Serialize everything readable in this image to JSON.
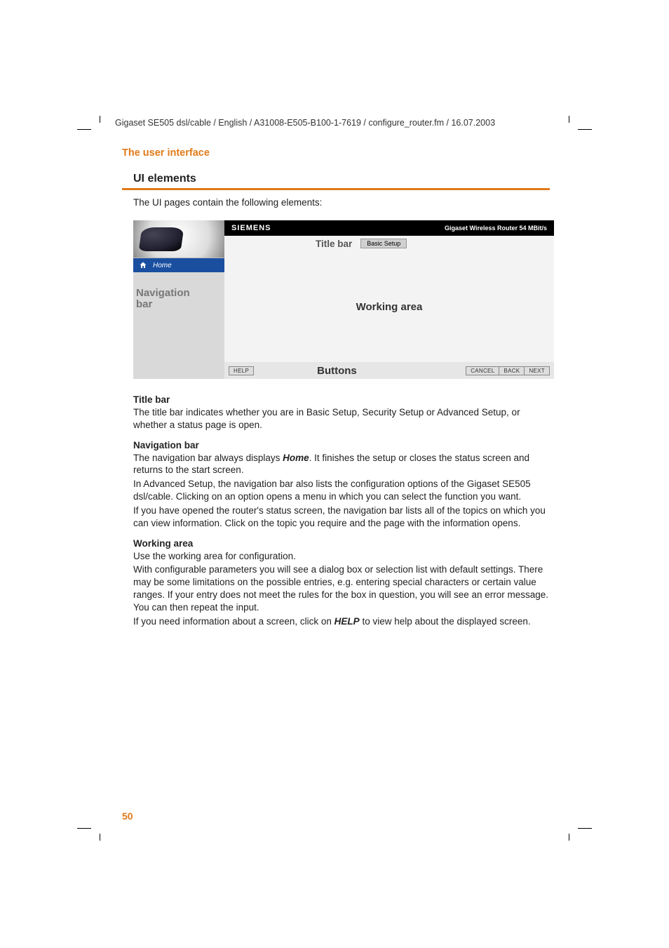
{
  "header_path": "Gigaset SE505 dsl/cable / English / A31008-E505-B100-1-7619 / configure_router.fm / 16.07.2003",
  "section_label": "The user interface",
  "heading": "UI elements",
  "intro": "The UI pages contain the following elements:",
  "shot": {
    "brand": "SIEMENS",
    "product": "Gigaset Wireless Router 54 MBit/s",
    "titlebar_label": "Title bar",
    "titlebar_chip": "Basic Setup",
    "home": "Home",
    "nav_label_l1": "Navigation",
    "nav_label_l2": "bar",
    "working_area": "Working area",
    "buttons_label": "Buttons",
    "btn_help": "HELP",
    "btn_cancel": "CANCEL",
    "btn_back": "BACK",
    "btn_next": "NEXT"
  },
  "sections": {
    "title_bar_h": "Title bar",
    "title_bar_p": "The title bar indicates whether you are in Basic Setup, Security Setup or Advanced Setup, or whether a status page is open.",
    "nav_h": "Navigation bar",
    "nav_p1a": "The navigation bar always displays ",
    "nav_p1b": "Home",
    "nav_p1c": ". It finishes the setup or closes the status screen and returns to the start screen.",
    "nav_p2": "In Advanced Setup, the navigation bar also lists the configuration options of the Gigaset SE505 dsl/cable. Clicking on an option opens a menu in which you can select the function you want.",
    "nav_p3": "If you have opened the router's status screen, the navigation bar lists all of the topics on which you can view information. Click on the topic you require and the page with the information opens.",
    "work_h": "Working area",
    "work_p1": "Use the working area for configuration.",
    "work_p2": "With configurable parameters you will see a dialog box or selection list with default settings. There may be some limitations on the possible entries, e.g. entering special characters or certain value ranges. If your entry does not meet the rules for the box in question, you will see an error message. You can then repeat the input.",
    "work_p3a": "If you need information about a screen, click on ",
    "work_p3b": "HELP",
    "work_p3c": " to view help about the displayed screen."
  },
  "page_number": "50"
}
